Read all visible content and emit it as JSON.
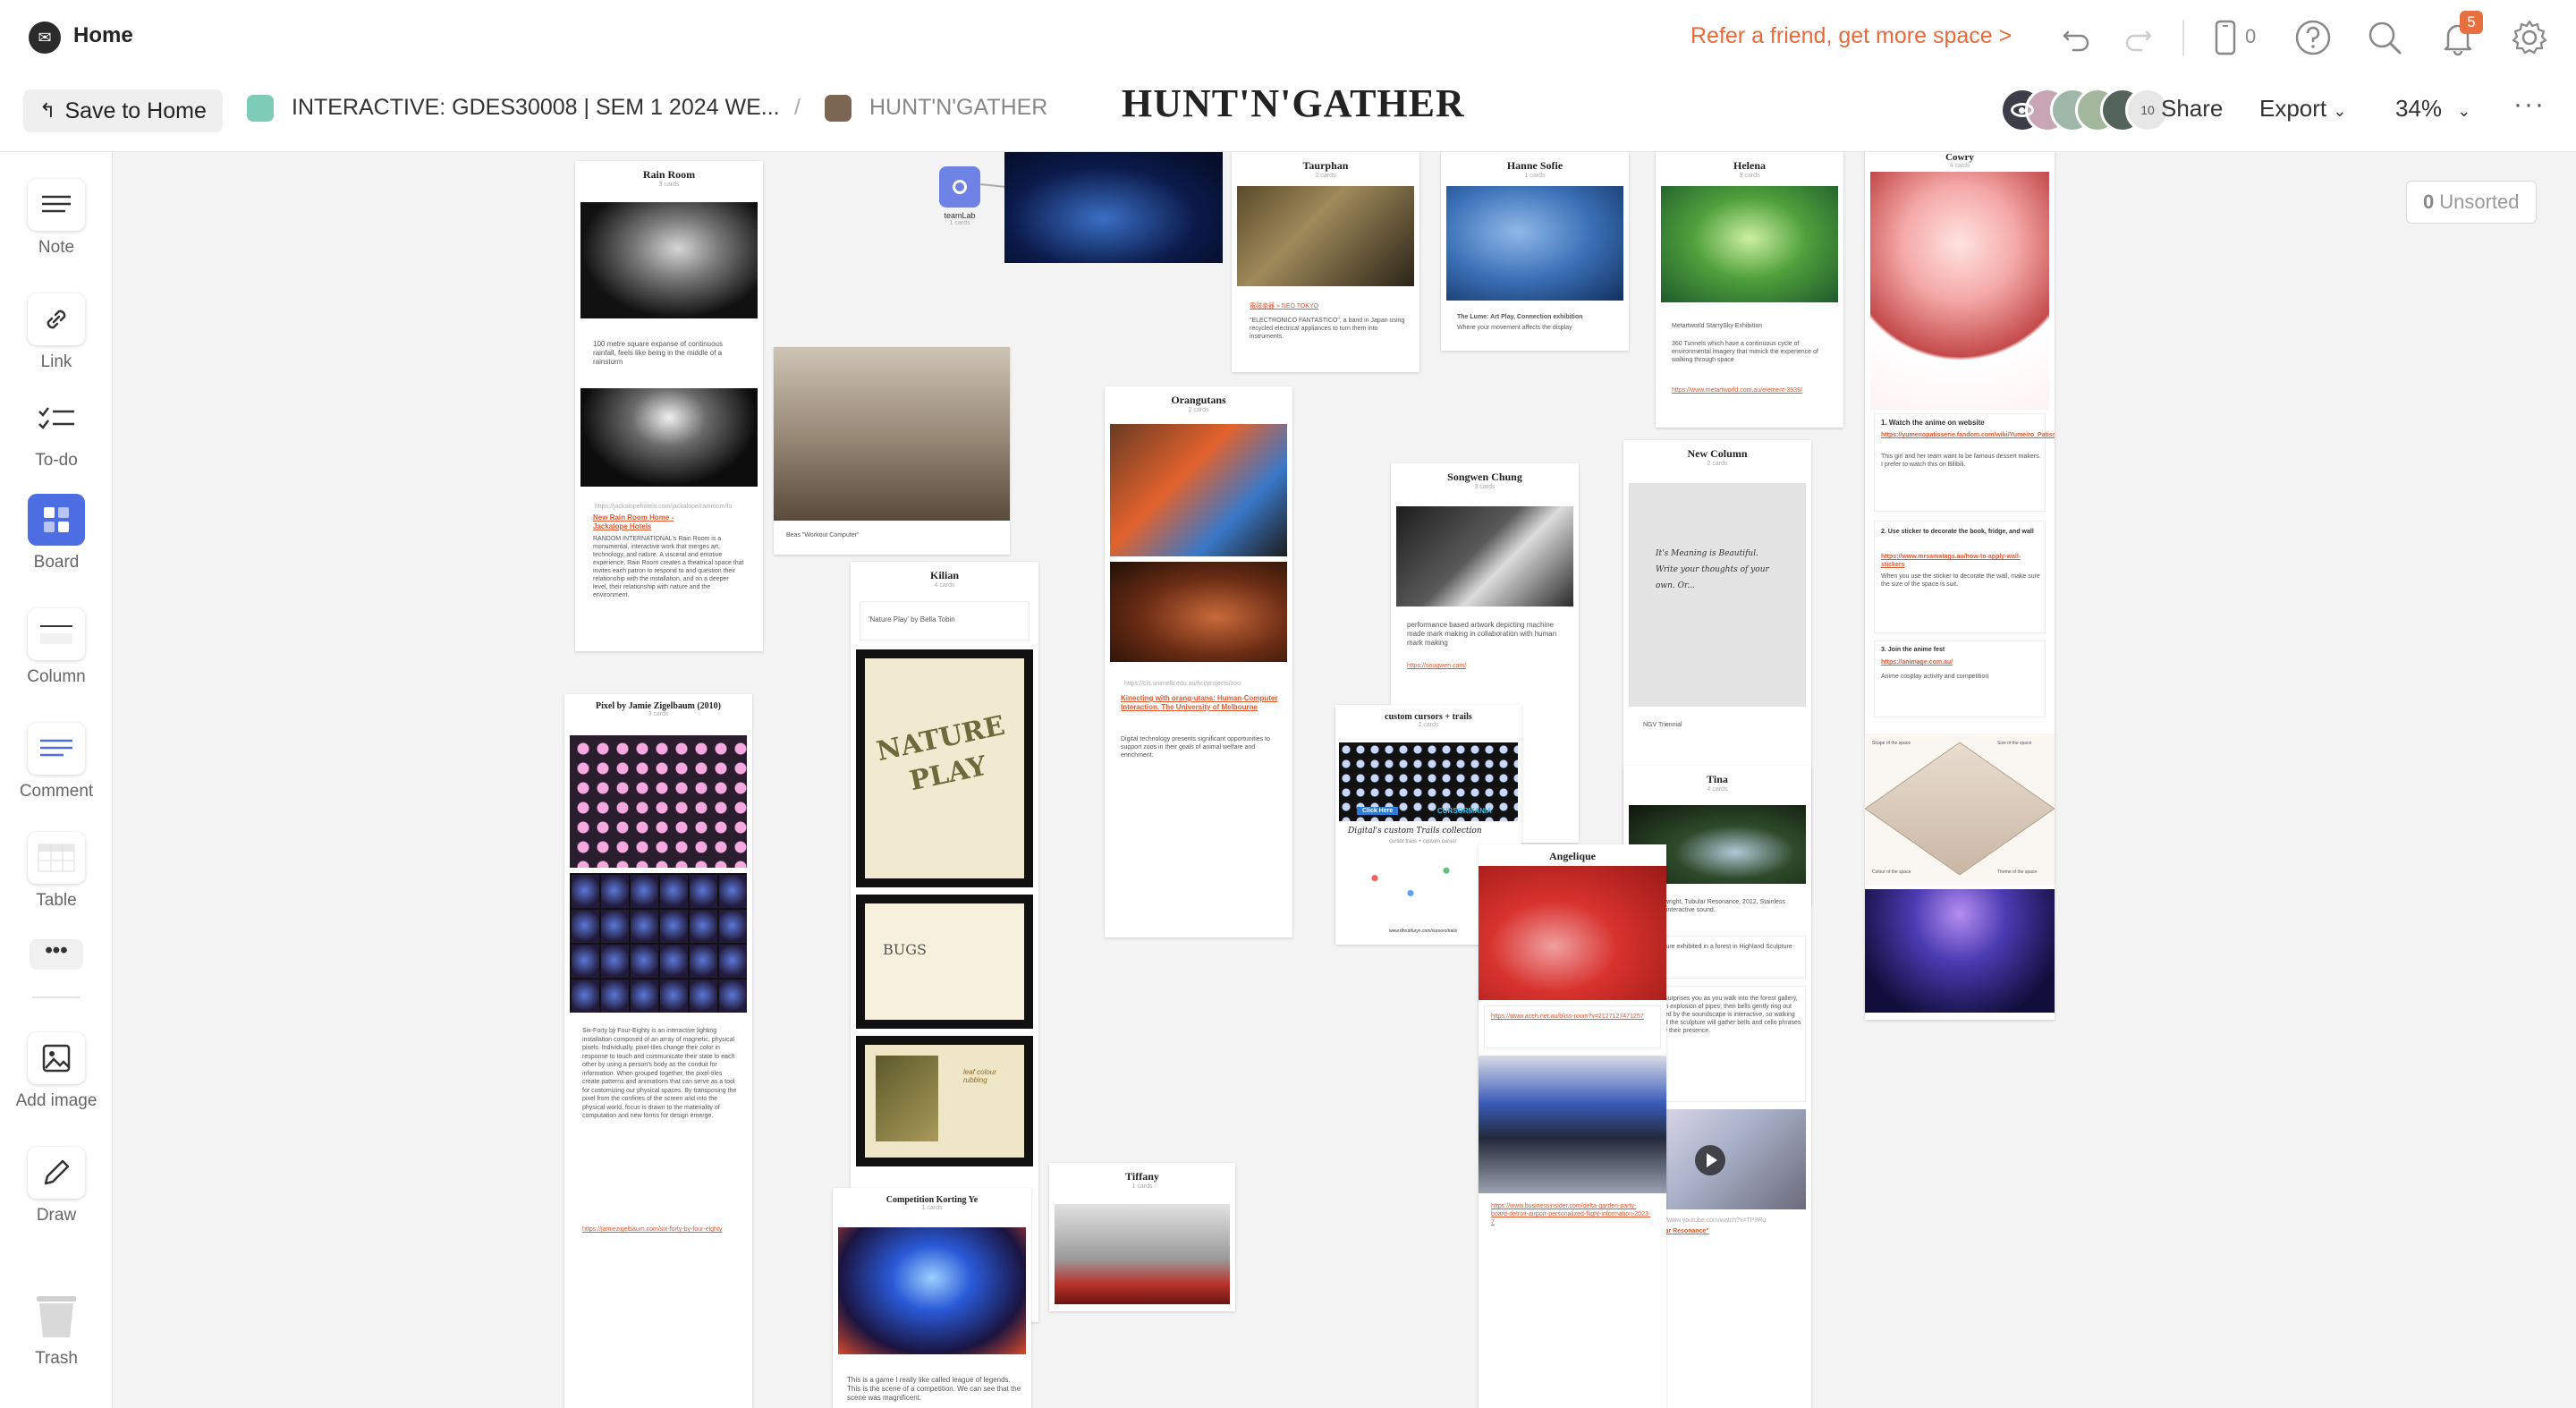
{
  "topbar": {
    "home_label": "Home",
    "refer_text": "Refer a friend, get more space >",
    "device_count": "0",
    "notification_count": "5",
    "icons": [
      "undo-icon",
      "redo-icon",
      "device-icon",
      "help-icon",
      "search-icon",
      "bell-icon",
      "gear-icon"
    ]
  },
  "toolbar2": {
    "save_label": "Save to Home",
    "breadcrumb": [
      {
        "label": "INTERACTIVE: GDES30008 | SEM 1 2024 WE...",
        "color": "#7ecbb7"
      },
      {
        "label": "HUNT'N'GATHER",
        "color": "#7b6654"
      }
    ],
    "board_title": "HUNT'N'GATHER",
    "avatar_extra": "10",
    "share_label": "Share",
    "export_label": "Export",
    "zoom_label": "34%"
  },
  "lefttools": [
    {
      "label": "Note",
      "icon": "note-icon"
    },
    {
      "label": "Link",
      "icon": "link-icon"
    },
    {
      "label": "To-do",
      "icon": "todo-icon"
    },
    {
      "label": "Board",
      "icon": "board-icon"
    },
    {
      "label": "Column",
      "icon": "column-icon"
    },
    {
      "label": "Comment",
      "icon": "comment-icon"
    },
    {
      "label": "Table",
      "icon": "table-icon"
    },
    {
      "label": "Add image",
      "icon": "image-icon"
    },
    {
      "label": "Draw",
      "icon": "pencil-icon"
    },
    {
      "label": "Trash",
      "icon": "trash-icon"
    }
  ],
  "canvas": {
    "unsorted_count": "0",
    "unsorted_label": "Unsorted",
    "teamlab": {
      "title": "teamLab",
      "sub": "1 cards"
    },
    "cards": {
      "rain_room": {
        "title": "Rain Room",
        "sub": "3 cards",
        "text1": "100 metre square expanse of continuous rainfall, feels like being in the middle of a rainstorm",
        "url": "https://jackalopehotels.com/jackalope/rainroom/fo",
        "link": "New Rain Room Home - Jackalope Hotels",
        "text2": "RANDOM INTERNATIONAL's Rain Room is a monumental, interactive work that merges art, technology, and nature. A visceral and emotive experience, Rain Room creates a theatrical space that invites each patron to respond to and question their relationship with the installation, and on a deeper level, their relationship with nature and the environment."
      },
      "workout": {
        "caption": "Beas \"Workout Computer\""
      },
      "taurphan": {
        "title": "Taurphan",
        "sub": "2 cards",
        "link": "電磁楽器 » NEO TOKYO",
        "text": "\"ELECTRONICO FANTASTICO\", a band in Japan using recycled electrical appliances to turn them into instruments."
      },
      "hanne": {
        "title": "Hanne Sofie",
        "sub": "1 cards",
        "caption": "The Lume: Art Play, Connection exhibition",
        "text": "Where your movement affects the display"
      },
      "helena": {
        "title": "Helena",
        "sub": "3 cards",
        "text1": "Metartworld StarrySky Exhibition",
        "text2": "360 Tunnels which have a continuous cycle of environmental imagery that mimick the experience of walking through space",
        "link": "https://www.metartworld.com.au/element-3939/"
      },
      "cowry": {
        "title": "Cowry",
        "sub": "4 cards",
        "s1": "1. Watch the anime on website",
        "l1": "https://yumenopatisserie.fandom.com/wiki/Yumeiro_Patissiere_Wiki",
        "t1": "This girl and her team want to be famous dessert makers. I prefer to watch this on Bilibili.",
        "s2": "2. Use sticker to decorate the book, fridge, and wall",
        "l2": "https://www.mrsamstags.au/how-to-apply-wall-stickers",
        "t2": "When you use the sticker to decorate the wall, make sure the size of the space is suit.",
        "s3": "3. Join the anime fest",
        "l3": "https://animage.com.au/",
        "t3": "Anime cosplay activity and competition",
        "room_labels": [
          "Shape of the space",
          "Size of the space",
          "Colour of the space",
          "Theme of the space"
        ]
      },
      "orangutans": {
        "title": "Orangutans",
        "sub": "2 cards",
        "url": "https://cis.unimelb.edu.au/hci/projects/zoo",
        "link": "Kinecting with orang-utans: Human-Computer Interaction. The University of Melbourne",
        "text": "Digital technology presents significant opportunities to support zoos in their goals of animal welfare and enrichment."
      },
      "songwen": {
        "title": "Songwen Chung",
        "sub": "3 cards",
        "text": "performance based artwork depicting machine made mark making in collaboration with human mark making",
        "link": "https://sougwen.com/"
      },
      "newcol": {
        "title": "New Column",
        "sub": "2 cards",
        "handwriting": "It's Meaning is Beautiful. Write your thoughts of your own. Or...",
        "caption": "NGV Triennial"
      },
      "pixel": {
        "title": "Pixel by Jamie Zigelbaum (2010)",
        "sub": "3 cards",
        "text": "Six-Forty by Four-Eighty is an interactive lighting installation composed of an array of magnetic, physical pixels. Individually, pixel-tiles change their color in response to touch and communicate their state to each other by using a person's body as the conduit for information. When grouped together, the pixel-tiles create patterns and animations that can serve as a tool for customizing our physical spaces. By transposing the pixel from the confines of the screen and into the physical world, focus is drawn to the materiality of computation and new forms for design emerge.",
        "link": "https://jamiezigelbaum.com/six-forty-by-four-eighty"
      },
      "kilian": {
        "title": "Kilian",
        "sub": "4 cards",
        "caption": "'Nature Play' by Bella Tobin",
        "book_text": "NATURE PLAY",
        "bugs_text": "BUGS",
        "leaf_text": "leaf colour rubbing"
      },
      "cursors": {
        "title": "custom cursors + trails",
        "sub": "2 cards",
        "badge": "Click Here",
        "logo": "CURSORMANIA",
        "collection": "Digital's custom Trails collection",
        "collection_sub": "cursor trails + custom cursor",
        "footer": "www.dhrutifuryn.com/cursors/trails"
      },
      "angelique": {
        "title": "Angelique",
        "sub": "",
        "link1": "https://www.aceh.net.au/bliss-room?v=2127127471257",
        "link2": "https://www.businessinsider.com/delta-garden-party-board-detroit-airport-personalized-flight-information-2023-7"
      },
      "tina": {
        "title": "Tina",
        "sub": "4 cards",
        "text1": "Jo Powright, Tubular Resonance, 2012, Stainless Steel, interactive sound.",
        "text2": "Sculpture exhibited in a forest in Highland Sculpture Park.",
        "text3": "Work surprises you as you walk into the forest gallery, with an explosion of pipes; then bells gently ring out followed by the soundscape is interactive, so walking around the sculpture will gather bells and cello phrases and by their presence.",
        "url": "https://www.youtube.com/watch?v=TP9Ru",
        "link": "Tubular Resonance\""
      },
      "competition": {
        "title": "Competition Korting Ye",
        "sub": "1 cards",
        "text": "This is a game I really like called league of legends. This is the scene of a competition. We can see that the scene was magnificent."
      },
      "tiffany": {
        "title": "Tiffany",
        "sub": "1 cards"
      }
    }
  }
}
